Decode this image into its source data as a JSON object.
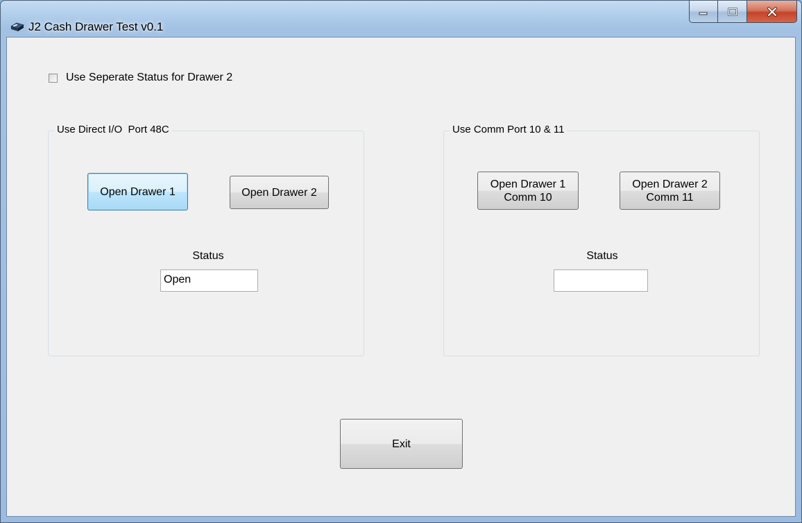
{
  "window": {
    "title": "J2 Cash Drawer Test v0.1",
    "icon": "cash-drawer-icon"
  },
  "caption": {
    "minimize_icon": "minimize-icon",
    "maximize_icon": "maximize-icon",
    "close_icon": "close-icon"
  },
  "options": {
    "separate_status_label": "Use Seperate Status for Drawer 2",
    "separate_status_checked": false
  },
  "direct_io_group": {
    "label": "Use Direct I/O  Port 48C",
    "open_drawer_1": "Open Drawer 1",
    "open_drawer_2": "Open Drawer 2",
    "status_label": "Status",
    "status_value": "Open"
  },
  "comm_group": {
    "label": "Use Comm Port 10 & 11",
    "open_drawer_1": "Open Drawer 1\nComm 10",
    "open_drawer_2": "Open Drawer 2\nComm 11",
    "status_label": "Status",
    "status_value": ""
  },
  "footer": {
    "exit_label": "Exit"
  },
  "colors": {
    "client_bg": "#f0f0f0",
    "focus_border": "#3c7fb1",
    "close_button": "#c3442a"
  }
}
